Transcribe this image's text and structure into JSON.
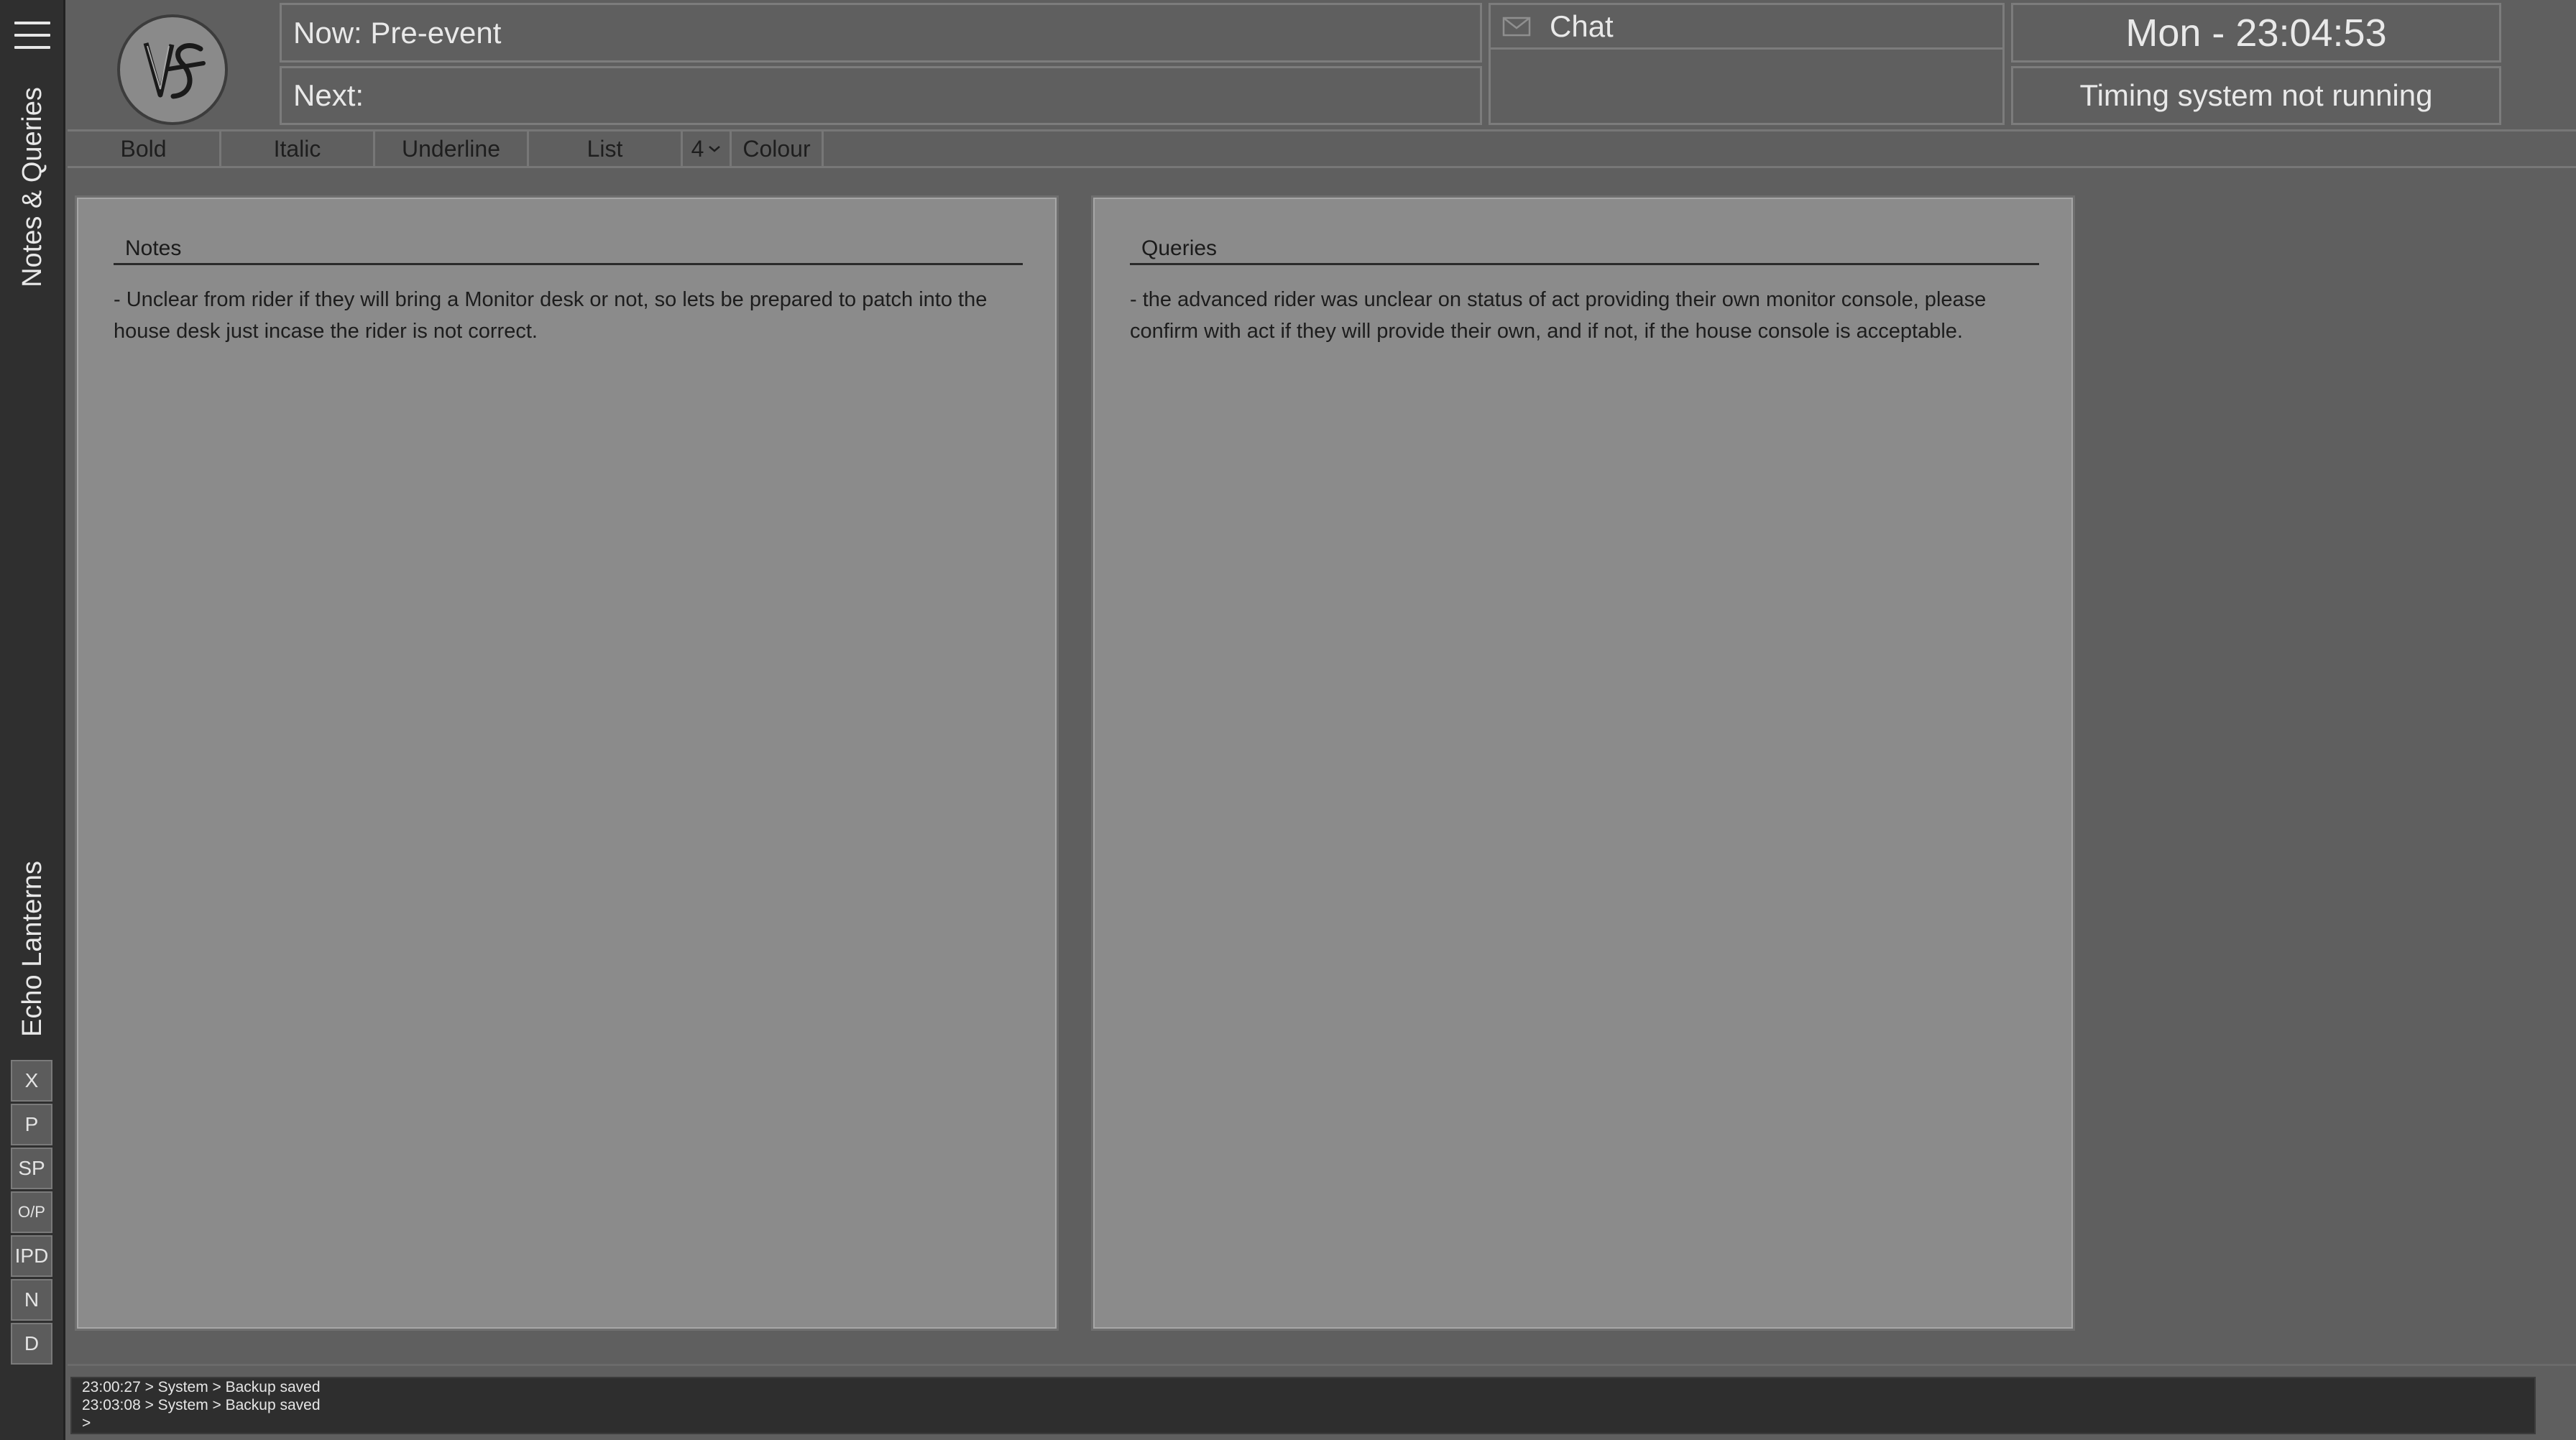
{
  "sidebar": {
    "tabs": [
      {
        "label": "Notes & Queries"
      },
      {
        "label": "Echo Lanterns"
      }
    ],
    "tool_buttons": [
      {
        "label": "X"
      },
      {
        "label": "P"
      },
      {
        "label": "SP"
      },
      {
        "label": "O/P"
      },
      {
        "label": "IPD"
      },
      {
        "label": "N"
      },
      {
        "label": "D"
      }
    ]
  },
  "header": {
    "now": "Now: Pre-event",
    "next": "Next:",
    "chat_label": "Chat",
    "clock": "Mon - 23:04:53",
    "timing_status": "Timing system not running"
  },
  "toolbar": {
    "bold": "Bold",
    "italic": "Italic",
    "underline": "Underline",
    "list": "List",
    "font_size": "4",
    "colour": "Colour"
  },
  "notes": {
    "title": "Notes",
    "text": "- Unclear from rider if they will bring a Monitor desk or not, so lets be prepared to patch into the house desk just incase the rider is not correct."
  },
  "queries": {
    "title": "Queries",
    "text": "- the advanced rider was unclear on status of act providing their own monitor console, please confirm with act if they will provide their own, and if not, if the house console is acceptable."
  },
  "console": {
    "lines": [
      "23:00:27 > System > Backup saved",
      "23:03:08 > System > Backup saved",
      ">"
    ]
  }
}
